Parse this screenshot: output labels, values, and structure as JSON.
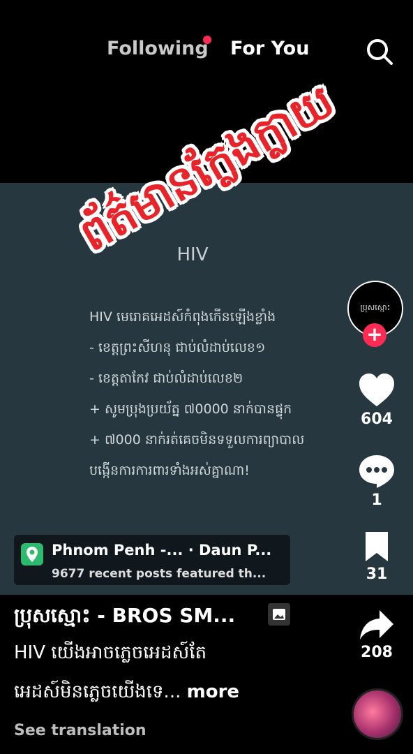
{
  "top_nav": {
    "following_label": "Following",
    "for_you_label": "For You",
    "search_icon": "search-icon"
  },
  "watermark": {
    "text": "ព័ត៌មានក្លែងក្លាយ"
  },
  "video": {
    "title": "HIV",
    "lines": [
      "HIV មេរោគអេដស៍កំពុងកើនឡើងខ្លាំង",
      "- ខេត្តព្រះសីហនុ ជាប់លំដាប់លេខ១",
      "- ខេត្តតាកែវ ជាប់លំដាប់លេខ២",
      "+ សូមប្រុងប្រយ័ត្ន ៧0000 នាក់បានផ្ទុក",
      "+ ៧000 នាក់រត់គេចមិនទទួលការព្យាបាល",
      "បង្កើនការការពារទាំងអស់គ្នាណា!"
    ]
  },
  "profile": {
    "avatar_text": "ប្រុសស្មោះ",
    "follow_icon": "plus-icon"
  },
  "actions": {
    "likes": "604",
    "comments": "1",
    "bookmarks": "31",
    "shares": "208"
  },
  "location": {
    "name": "Phnom Penh -...   · Daun P...",
    "sub": "9677 recent posts featured th..."
  },
  "author": {
    "name": "ប្រុសស្មោះ - BROS SM..."
  },
  "caption": {
    "line1": "HIV យើងអាចភ្លេចអេដស៍តែ",
    "line2": "អេដស៍មិនភ្លេចយើងទេ...",
    "more": "more",
    "see_translation": "See translation"
  },
  "colors": {
    "accent": "#fe2c55",
    "video_bg": "#263740",
    "watermark_red": "#e8242b",
    "location_pin": "#2dba6e"
  }
}
